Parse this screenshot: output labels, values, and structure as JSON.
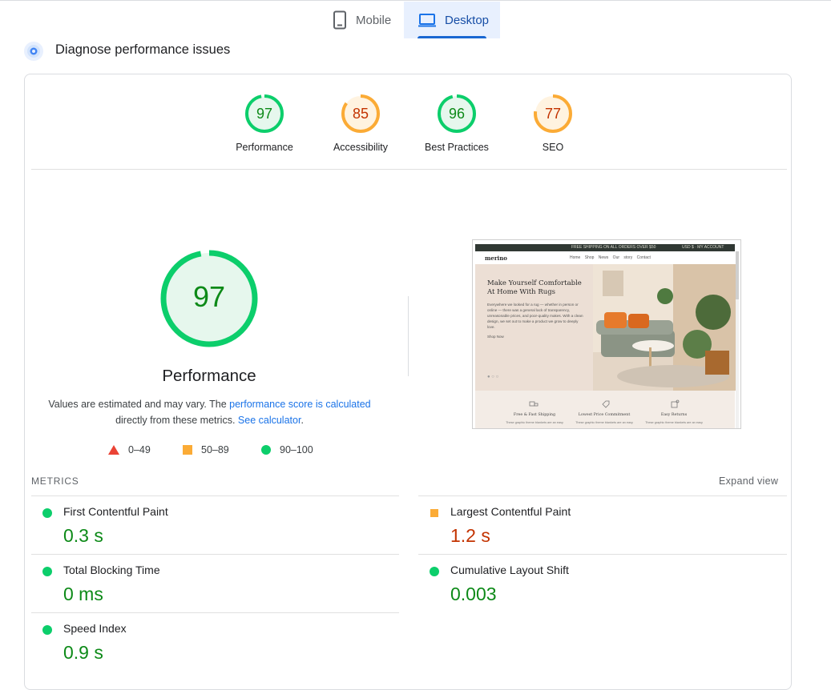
{
  "tabs": [
    {
      "label": "Mobile",
      "selected": false
    },
    {
      "label": "Desktop",
      "selected": true
    }
  ],
  "section_title": "Diagnose performance issues",
  "category_scores": [
    {
      "label": "Performance",
      "score": 97,
      "status": "pass"
    },
    {
      "label": "Accessibility",
      "score": 85,
      "status": "average"
    },
    {
      "label": "Best Practices",
      "score": 96,
      "status": "pass"
    },
    {
      "label": "SEO",
      "score": 77,
      "status": "average"
    }
  ],
  "main_gauge": {
    "score": 97,
    "title": "Performance"
  },
  "description": {
    "part1": "Values are estimated and may vary. The ",
    "link1": "performance score is calculated",
    "part2": " directly from these metrics. ",
    "link2": "See calculator",
    "part3": "."
  },
  "legend": [
    {
      "range": "0–49",
      "shape": "triangle",
      "color": "#ea4335"
    },
    {
      "range": "50–89",
      "shape": "square",
      "color": "#fbab36"
    },
    {
      "range": "90–100",
      "shape": "circle",
      "color": "#0cce6b"
    }
  ],
  "preview": {
    "announcement": "FREE SHIPPING ON ALL ORDERS OVER $50",
    "account_text": "USD $  ·  MY ACCOUNT",
    "logo": "merino",
    "menu": "Home Shop News Our story Contact",
    "hero_title": "Make Yourself Comfortable At Home With Rugs",
    "hero_text": "Everywhere we looked for a rug — whether in person or online — there was a general lack of transparency, unreasonable prices, and poor-quality makes. With a clean design, we set out to make a product we grow to deeply love.",
    "hero_cta": "Shop Now",
    "features": [
      "Free & Fast Shipping",
      "Lowest Price Commitment",
      "Easy Returns"
    ],
    "feature_sub": "These graphic theme blankets are an easy"
  },
  "metrics_title": "METRICS",
  "expand_label": "Expand view",
  "metrics": [
    {
      "name": "First Contentful Paint",
      "value": "0.3 s",
      "status": "pass"
    },
    {
      "name": "Largest Contentful Paint",
      "value": "1.2 s",
      "status": "average"
    },
    {
      "name": "Total Blocking Time",
      "value": "0 ms",
      "status": "pass"
    },
    {
      "name": "Cumulative Layout Shift",
      "value": "0.003",
      "status": "pass"
    },
    {
      "name": "Speed Index",
      "value": "0.9 s",
      "status": "pass"
    }
  ],
  "colors": {
    "pass": "#0cce6b",
    "pass_text": "#0d8a18",
    "pass_fill": "#e6f7ed",
    "average": "#fbab36",
    "average_text": "#c33300",
    "average_fill": "#fff3e0",
    "accent": "#1a73e8"
  }
}
